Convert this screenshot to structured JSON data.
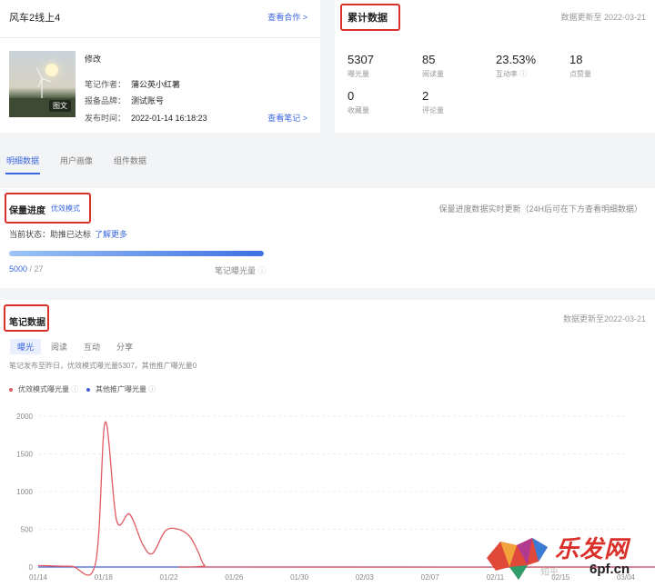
{
  "note": {
    "title": "风车2线上4",
    "coop_link": "查看合作 >",
    "edit": "修改",
    "thumb_tag": "图文",
    "author_label": "笔记作者：",
    "author": "蒲公英小红薯",
    "brand_label": "报备品牌：",
    "brand": "测试账号",
    "time_label": "发布时间：",
    "time": "2022-01-14 16:18:23",
    "view_note": "查看笔记 >"
  },
  "cumulative": {
    "title": "累计数据",
    "updated": "数据更新至 2022-03-21",
    "metrics": [
      {
        "value": "5307",
        "label": "曝光量"
      },
      {
        "value": "85",
        "label": "阅读量"
      },
      {
        "value": "23.53%",
        "label": "互动率"
      },
      {
        "value": "18",
        "label": "点赞量"
      },
      {
        "value": "0",
        "label": "收藏量"
      },
      {
        "value": "2",
        "label": "评论量"
      }
    ]
  },
  "tabs": [
    "明细数据",
    "用户画像",
    "组件数据"
  ],
  "progress": {
    "title": "保量进度",
    "mode": "优效模式",
    "hint": "保量进度数据实时更新（24H后可在下方查看明细数据）",
    "status_label": "当前状态：",
    "status": "助推已达标",
    "learn_more": "了解更多",
    "current": "5000",
    "total": "/ 27",
    "fill": 1.0,
    "bar_label": "笔记曝光量"
  },
  "note_data": {
    "title": "笔记数据",
    "updated": "数据更新至2022-03-21",
    "subtabs": [
      "曝光",
      "阅读",
      "互动",
      "分享"
    ],
    "desc": "笔记发布至昨日，优效模式曝光量5307，其他推广曝光量0",
    "legend": [
      {
        "name": "优效模式曝光量",
        "color": "#e05a64"
      },
      {
        "name": "其他推广曝光量",
        "color": "#3e5fd6"
      }
    ]
  },
  "chart_data": {
    "type": "line",
    "x_ticks": [
      "01/14",
      "01/18",
      "01/22",
      "01/26",
      "01/30",
      "02/03",
      "02/07",
      "02/11",
      "02/15",
      "03/04"
    ],
    "y_ticks": [
      0,
      500,
      1000,
      1500,
      2000
    ],
    "ylim": [
      0,
      2000
    ],
    "series": [
      {
        "name": "优效模式曝光量",
        "color": "#e05a64",
        "points": [
          [
            0,
            20
          ],
          [
            2,
            10
          ],
          [
            3.5,
            40
          ],
          [
            4.1,
            1920
          ],
          [
            4.8,
            620
          ],
          [
            5.6,
            700
          ],
          [
            6.4,
            300
          ],
          [
            7.0,
            180
          ],
          [
            7.8,
            480
          ],
          [
            8.6,
            500
          ],
          [
            9.3,
            400
          ],
          [
            9.8,
            200
          ],
          [
            10.2,
            20
          ],
          [
            11,
            0
          ],
          [
            40,
            0
          ]
        ]
      },
      {
        "name": "其他推广曝光量",
        "color": "#3e5fd6",
        "points": [
          [
            0,
            0
          ],
          [
            40,
            0
          ]
        ]
      }
    ]
  },
  "watermark": {
    "text_cn": "乐发网",
    "url": "6pf.cn",
    "small": "知乎"
  }
}
